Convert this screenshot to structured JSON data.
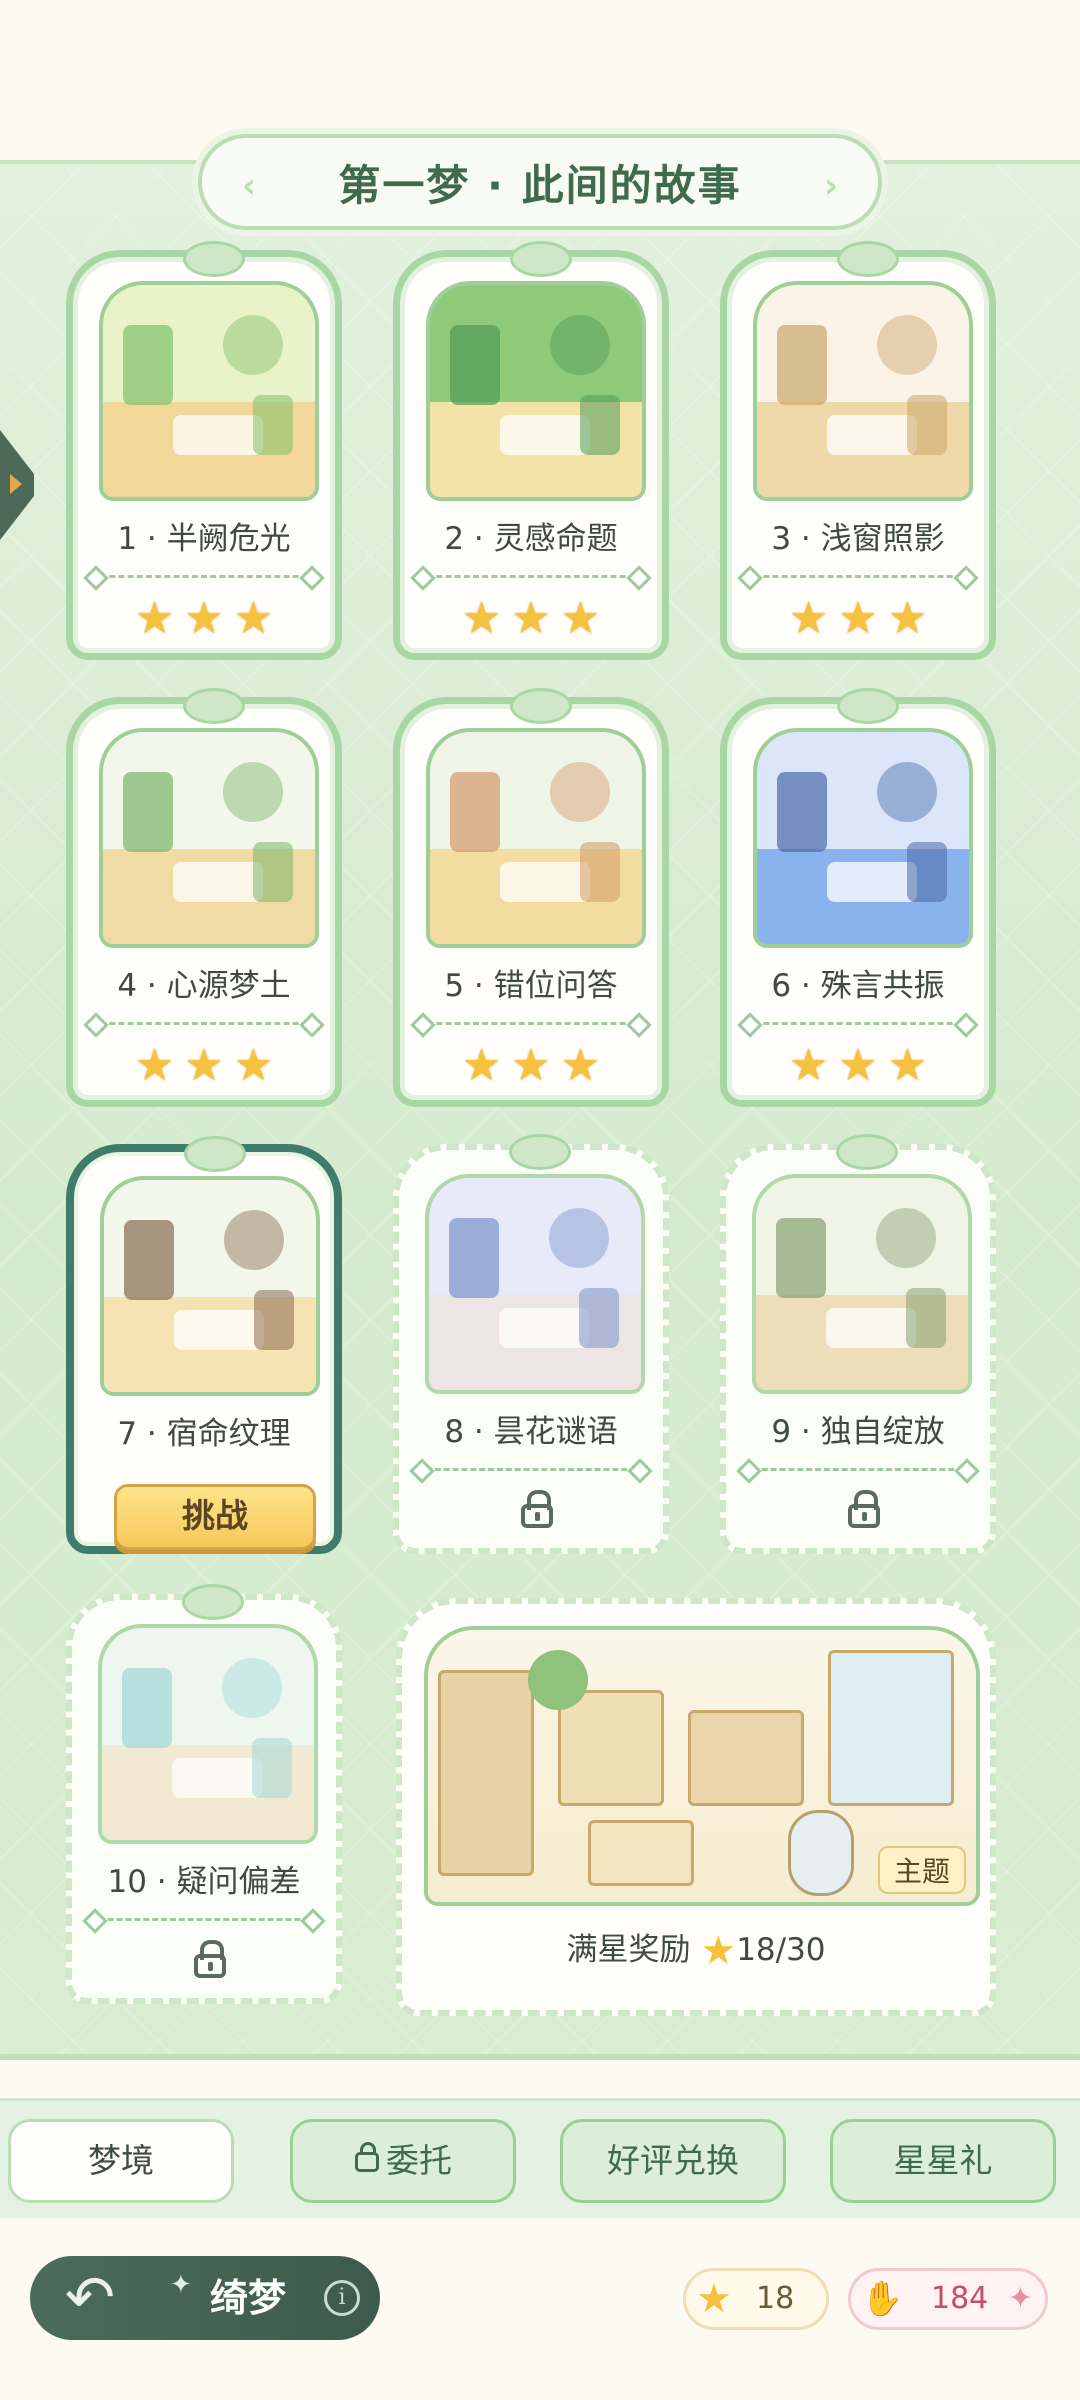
{
  "chapter": {
    "title": "第一梦 · 此间的故事"
  },
  "levels": [
    {
      "label": "1 · 半阙危光",
      "stars": 3,
      "state": "cleared",
      "palette": [
        "#eaf3c8",
        "#f2d79a",
        "#7fbf6a"
      ]
    },
    {
      "label": "2 · 灵感命题",
      "stars": 3,
      "state": "cleared",
      "palette": [
        "#8fca7a",
        "#f3e3a8",
        "#4f9a55"
      ]
    },
    {
      "label": "3 · 浅窗照影",
      "stars": 3,
      "state": "cleared",
      "palette": [
        "#fbf4e6",
        "#f0d9a8",
        "#c8a56b"
      ]
    },
    {
      "label": "4 · 心源梦土",
      "stars": 3,
      "state": "cleared",
      "palette": [
        "#f3f6ea",
        "#f1dba4",
        "#7ab56b"
      ]
    },
    {
      "label": "5 · 错位问答",
      "stars": 3,
      "state": "cleared",
      "palette": [
        "#eef4e6",
        "#f2dca0",
        "#d29a6a"
      ]
    },
    {
      "label": "6 · 殊言共振",
      "stars": 3,
      "state": "cleared",
      "palette": [
        "#dbe6fa",
        "#8ab2ec",
        "#4a6aa8"
      ]
    },
    {
      "label": "7 · 宿命纹理",
      "stars": 0,
      "state": "current",
      "action": "挑战",
      "palette": [
        "#f2f7ea",
        "#f6e3b4",
        "#8a6a52"
      ]
    },
    {
      "label": "8 · 昙花谜语",
      "stars": 0,
      "state": "locked",
      "palette": [
        "#e2e6fa",
        "#eadfe0",
        "#5a7ac0"
      ]
    },
    {
      "label": "9 · 独自绽放",
      "stars": 0,
      "state": "locked",
      "palette": [
        "#eef3e0",
        "#ead7aa",
        "#6a8a52"
      ]
    },
    {
      "label": "10 · 疑问偏差",
      "stars": 0,
      "state": "locked",
      "palette": [
        "#eaf6ee",
        "#f1e5c9",
        "#8ccfcf"
      ]
    }
  ],
  "theme": {
    "tag": "主题",
    "reward_label": "满星奖励",
    "reward_value": "18/30"
  },
  "tabs": [
    {
      "label": "梦境",
      "active": true,
      "locked": false
    },
    {
      "label": "委托",
      "active": false,
      "locked": true
    },
    {
      "label": "好评兑换",
      "active": false,
      "locked": false
    },
    {
      "label": "星星礼",
      "active": false,
      "locked": false
    }
  ],
  "footer": {
    "name": "绮梦",
    "star_count": "18",
    "heart_count": "184"
  },
  "colors": {
    "accent": "#3f7c6c",
    "star": "#f6c23d",
    "panel": "#d5ebcf"
  }
}
